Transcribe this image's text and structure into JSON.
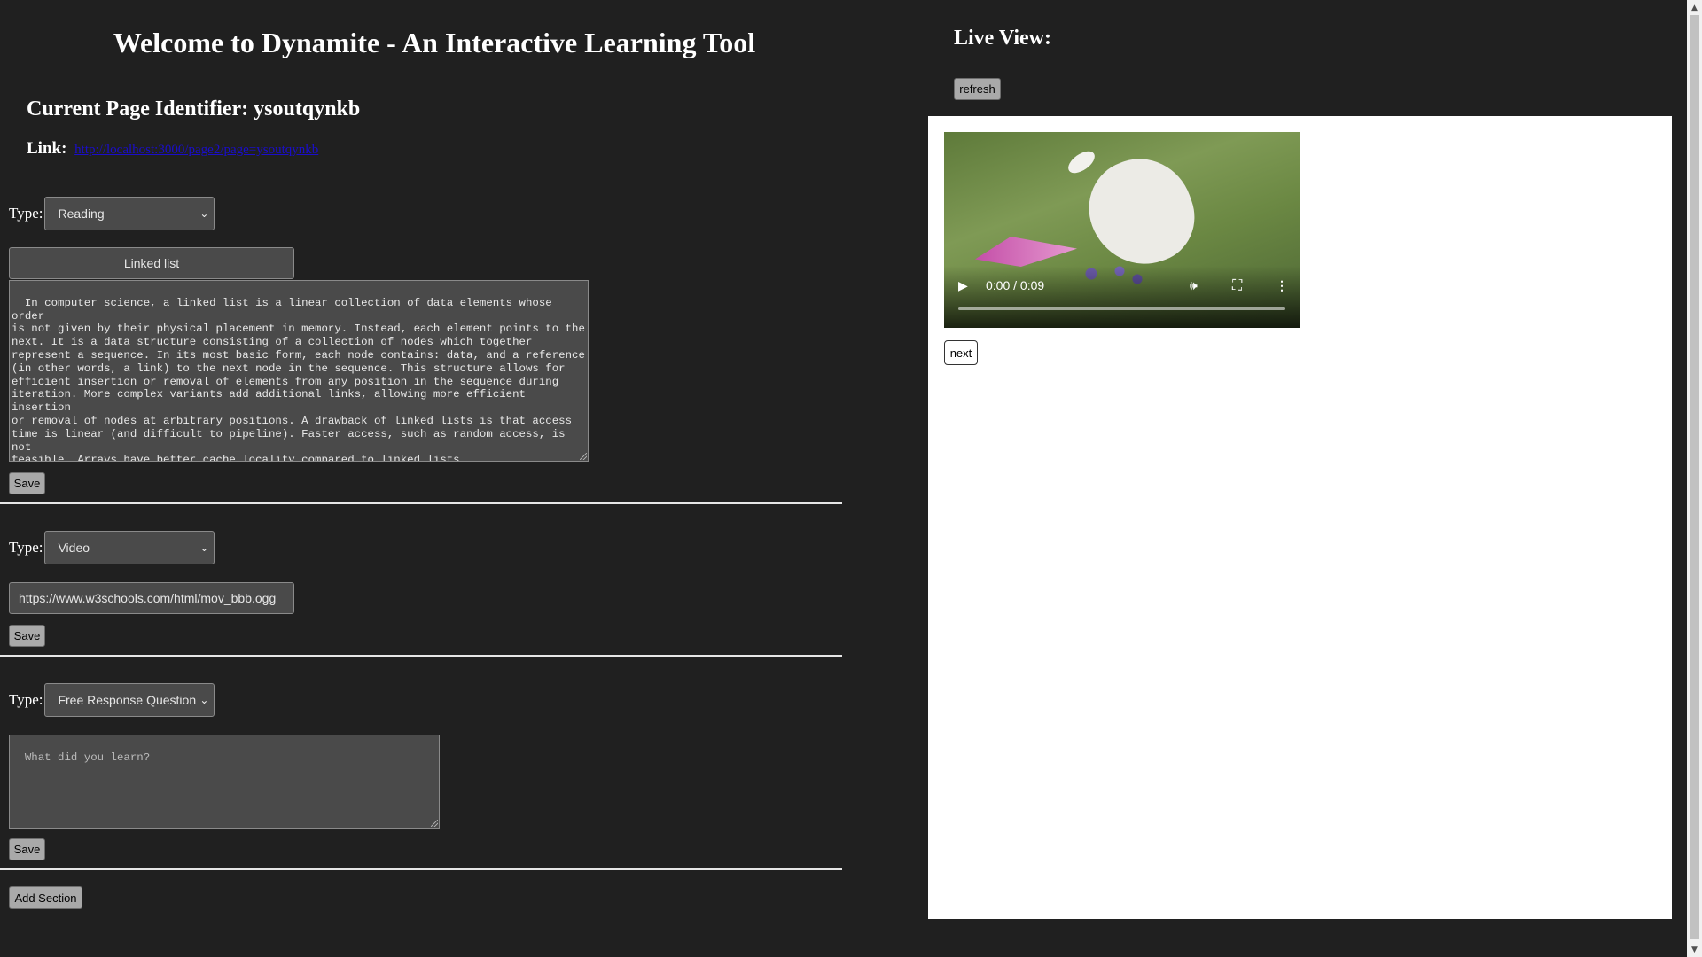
{
  "header": {
    "title": "Welcome to Dynamite - An Interactive Learning Tool",
    "page_identifier": "Current Page Identifier: ysoutqynkb",
    "link_label": "Link:",
    "link_url": "http://localhost:3000/page2/page=ysoutqynkb"
  },
  "common": {
    "type_label": "Type:",
    "save_label": "Save"
  },
  "sections": [
    {
      "type": "Reading",
      "title": "Linked list",
      "body": "In computer science, a linked list is a linear collection of data elements whose order\nis not given by their physical placement in memory. Instead, each element points to the\nnext. It is a data structure consisting of a collection of nodes which together\nrepresent a sequence. In its most basic form, each node contains: data, and a reference\n(in other words, a link) to the next node in the sequence. This structure allows for\nefficient insertion or removal of elements from any position in the sequence during\niteration. More complex variants add additional links, allowing more efficient insertion\nor removal of nodes at arbitrary positions. A drawback of linked lists is that access\ntime is linear (and difficult to pipeline). Faster access, such as random access, is not\nfeasible. Arrays have better cache locality compared to linked lists.\n\nSource: https://en.wikipedia.org/wiki/Linked_list"
    },
    {
      "type": "Video",
      "url": "https://www.w3schools.com/html/mov_bbb.ogg"
    },
    {
      "type": "Free Response Question",
      "placeholder": "What did you learn?"
    }
  ],
  "add_section_label": "Add Section",
  "live_view": {
    "heading": "Live View:",
    "refresh_label": "refresh",
    "video_time": "0:00 / 0:09",
    "video_progress": 0,
    "next_label": "next"
  },
  "icons": {
    "play": "play-icon",
    "volume": "volume-icon",
    "fullscreen": "fullscreen-icon",
    "more": "more-vert-icon",
    "dropdown": "chevron-down-icon"
  }
}
